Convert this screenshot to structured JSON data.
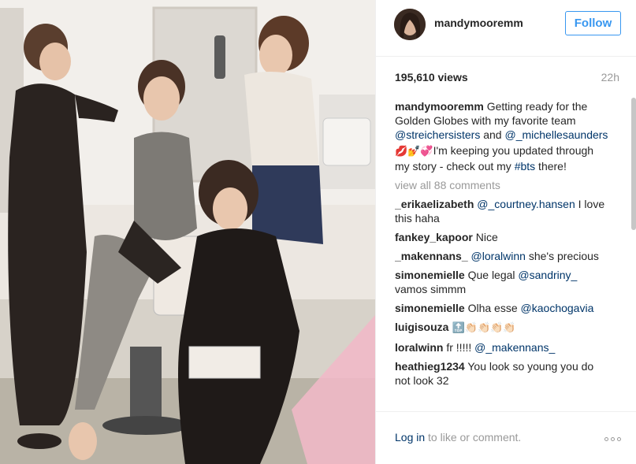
{
  "post": {
    "username": "mandymooremm",
    "follow_label": "Follow",
    "views": "195,610 views",
    "time": "22h"
  },
  "caption": {
    "username": "mandymooremm",
    "text_1": " Getting ready for the Golden Globes with my favorite team ",
    "mention_1": "@streichersisters",
    "text_2": " and ",
    "mention_2": "@_michellesaunders",
    "emoji": " 💋💅💞",
    "text_3": "I'm keeping you updated through my story - check out my ",
    "hashtag": "#bts",
    "text_4": " there!"
  },
  "view_all_label": "view all 88 comments",
  "comments": [
    {
      "user": "_erikaelizabeth",
      "mention": "@_courtney.hansen",
      "text": " I love this haha"
    },
    {
      "user": "fankey_kapoor",
      "text": " Nice"
    },
    {
      "user": "_makennans_",
      "mention": "@loralwinn",
      "text": " she's precious"
    },
    {
      "user": "simonemielle",
      "text": " Que legal ",
      "mention": "@sandriny_",
      "text_after": " vamos simmm"
    },
    {
      "user": "simonemielle",
      "text": " Olha esse ",
      "mention": "@kaochogavia"
    },
    {
      "user": "luigisouza",
      "text": " 🔝👏🏻👏🏻👏🏻👏🏻"
    },
    {
      "user": "loralwinn",
      "text": " fr !!!!! ",
      "mention": "@_makennans_"
    },
    {
      "user": "heathieg1234",
      "text": " You look so young you do not look 32"
    }
  ],
  "footer": {
    "login_link": "Log in",
    "login_text": " to like or comment."
  },
  "icons": {
    "more": "more-options-icon"
  },
  "colors": {
    "follow_blue": "#3897f0",
    "link_navy": "#003569",
    "muted": "#999999"
  }
}
